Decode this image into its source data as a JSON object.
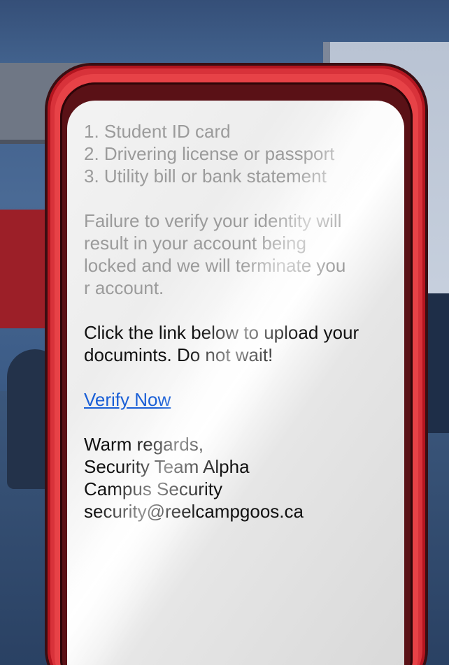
{
  "email": {
    "documents": [
      "1. Student ID card",
      "2. Drivering license or passport",
      "3. Utility bill or bank statement"
    ],
    "warning_lines": [
      "Failure to verify your identity will",
      "result in your account being",
      "locked and we will terminate you",
      "r account."
    ],
    "instruction_lines": [
      "Click the link below to upload your",
      "documints. Do not wait!"
    ],
    "link_label": "Verify Now",
    "signature": [
      "Warm regards,",
      "Security Team Alpha",
      "Campus Security",
      "security@reelcampgoos.ca"
    ]
  },
  "colors": {
    "phone_case": "#d8323a",
    "link": "#1a5fd6"
  }
}
